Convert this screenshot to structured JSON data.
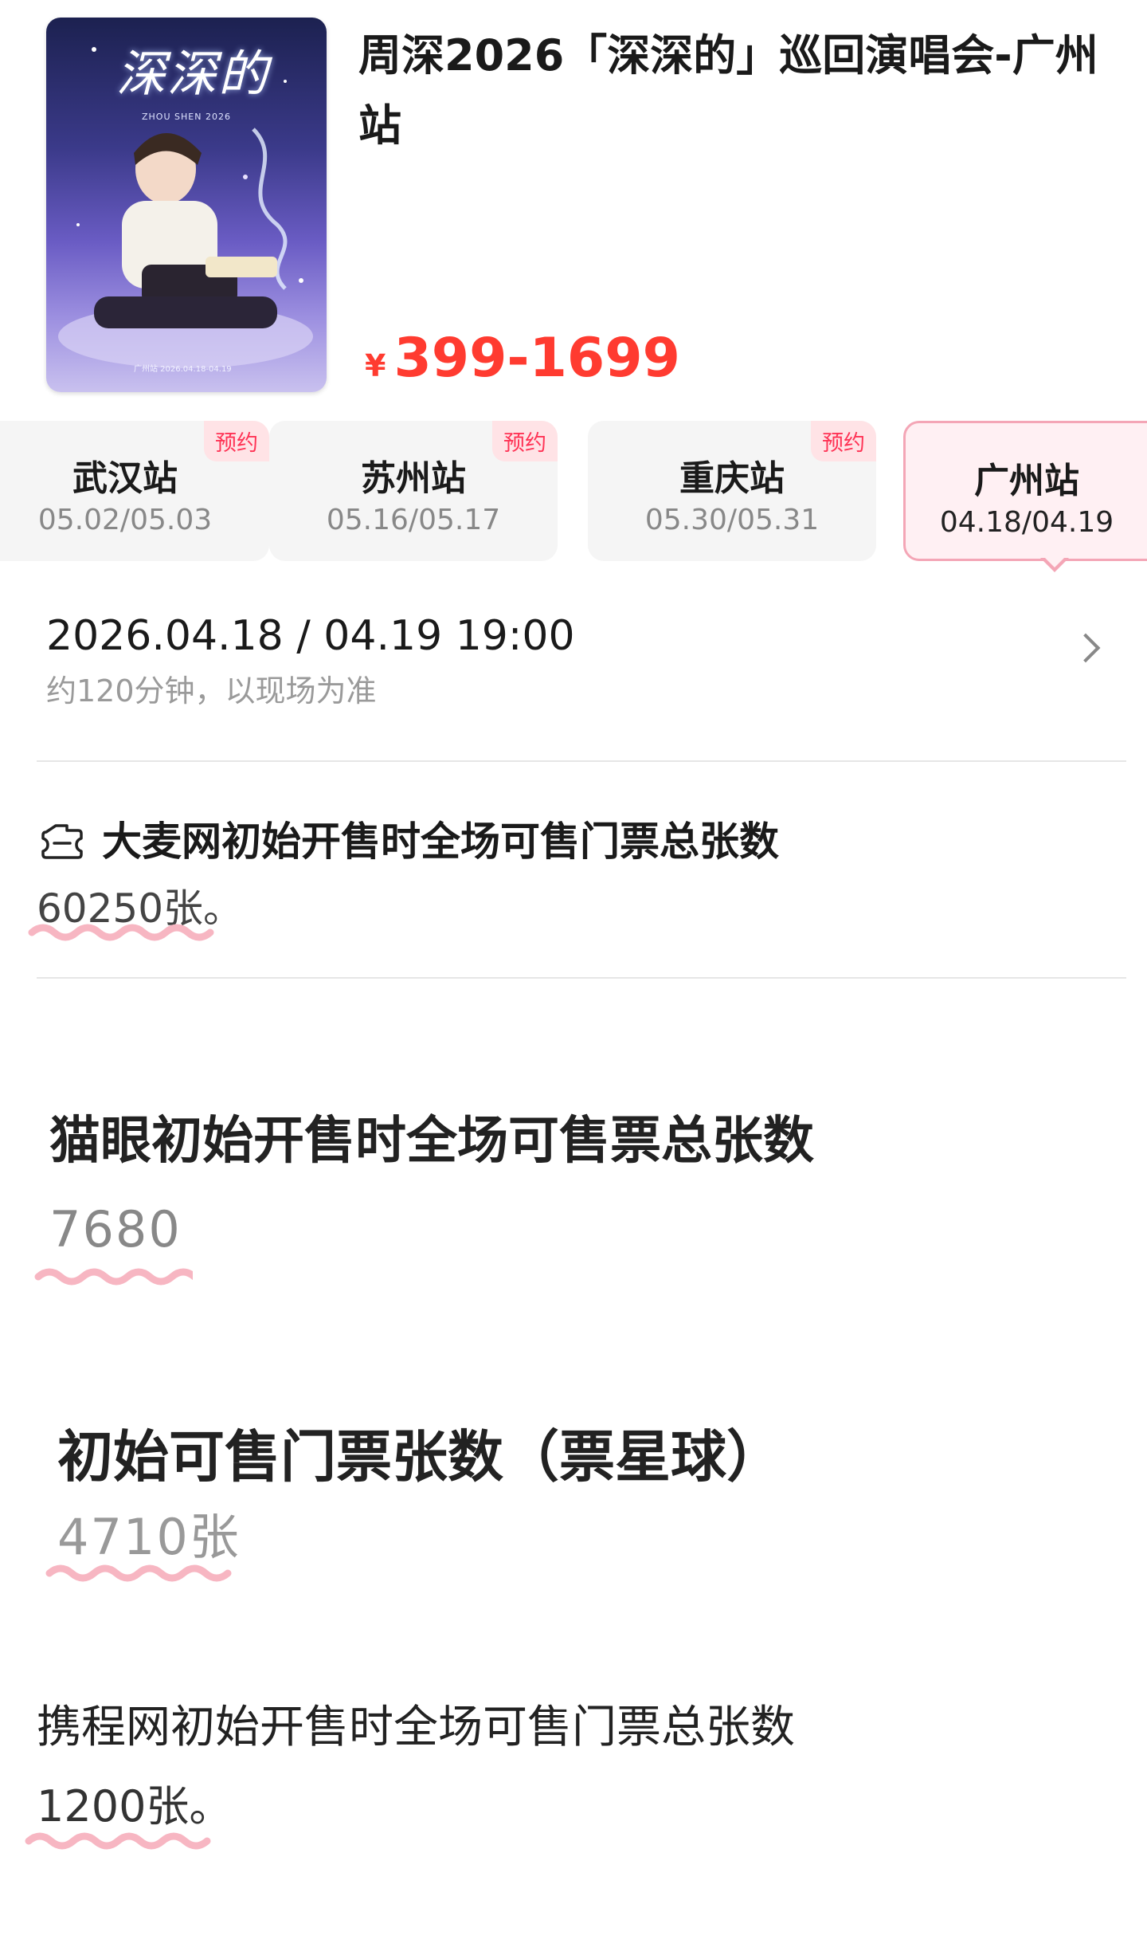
{
  "event": {
    "title": "周深2026「深深的」巡回演唱会-广州站",
    "price_symbol": "¥",
    "price_range": "399-1699",
    "price_color": "#ff3b30"
  },
  "poster": {
    "title_art": "深深的",
    "subtitle": "ZHOU SHEN 2026",
    "dates": "广州站 2026.04.18-04.19"
  },
  "cities": [
    {
      "name": "武汉站",
      "dates": "05.02/05.03",
      "badge": "预约",
      "selected": false
    },
    {
      "name": "苏州站",
      "dates": "05.16/05.17",
      "badge": "预约",
      "selected": false
    },
    {
      "name": "重庆站",
      "dates": "05.30/05.31",
      "badge": "预约",
      "selected": false
    },
    {
      "name": "广州站",
      "dates": "04.18/04.19",
      "badge": "",
      "selected": true
    }
  ],
  "session": {
    "datetime": "2026.04.18 / 04.19 19:00",
    "duration": "约120分钟，以现场为准",
    "chevron_icon": "chevron-right-icon"
  },
  "sections": {
    "damai": {
      "icon": "ticket-icon",
      "title": "大麦网初始开售时全场可售门票总张数",
      "value": "60250张。"
    },
    "maoyan": {
      "title": "猫眼初始开售时全场可售票总张数",
      "value": "7680"
    },
    "piaoxingqiu": {
      "title": "初始可售门票张数（票星球）",
      "value": "4710张"
    },
    "ctrip": {
      "title": "携程网初始开售时全场可售门票总张数",
      "value": "1200张。"
    }
  },
  "highlight_color": "#f7b6c2",
  "accent_border": "#f4a6b6"
}
